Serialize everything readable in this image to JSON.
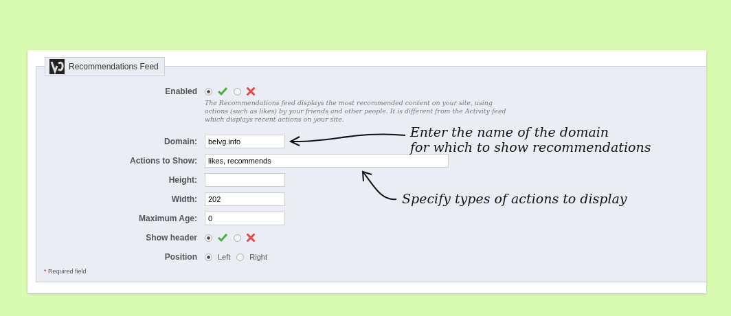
{
  "panel": {
    "legend": "Recommendations Feed",
    "fields": [
      {
        "kind": "toggle",
        "label": "Enabled",
        "options": [
          {
            "kind": "yes",
            "selected": true
          },
          {
            "kind": "no",
            "selected": false
          }
        ],
        "description": "The Recommendations feed displays the most recommended content on your site, using actions (such as likes) by your friends and other people. It is different from the Activity feed which displays recent actions on your site."
      },
      {
        "kind": "text",
        "label": "Domain:",
        "value": "belvg.info"
      },
      {
        "kind": "long_text",
        "label": "Actions to Show:",
        "value": "likes, recommends"
      },
      {
        "kind": "text",
        "label": "Height:"
      },
      {
        "kind": "text",
        "label": "Width:",
        "value": "202"
      },
      {
        "kind": "text",
        "label": "Maximum Age:",
        "value": "0"
      },
      {
        "kind": "toggle",
        "label": "Show header",
        "options": [
          {
            "kind": "yes",
            "selected": true
          },
          {
            "kind": "no",
            "selected": false
          }
        ]
      },
      {
        "kind": "choice",
        "label": "Position",
        "options": [
          {
            "label": "Left",
            "selected": true
          },
          {
            "label": "Right",
            "selected": false
          }
        ]
      }
    ],
    "required_note": {
      "mark": "*",
      "text": "Required field"
    }
  },
  "annotations": [
    {
      "lines": [
        "Enter the name of the domain",
        "for which to show recommendations"
      ]
    },
    {
      "lines": [
        "Specify types of actions to display"
      ]
    }
  ]
}
